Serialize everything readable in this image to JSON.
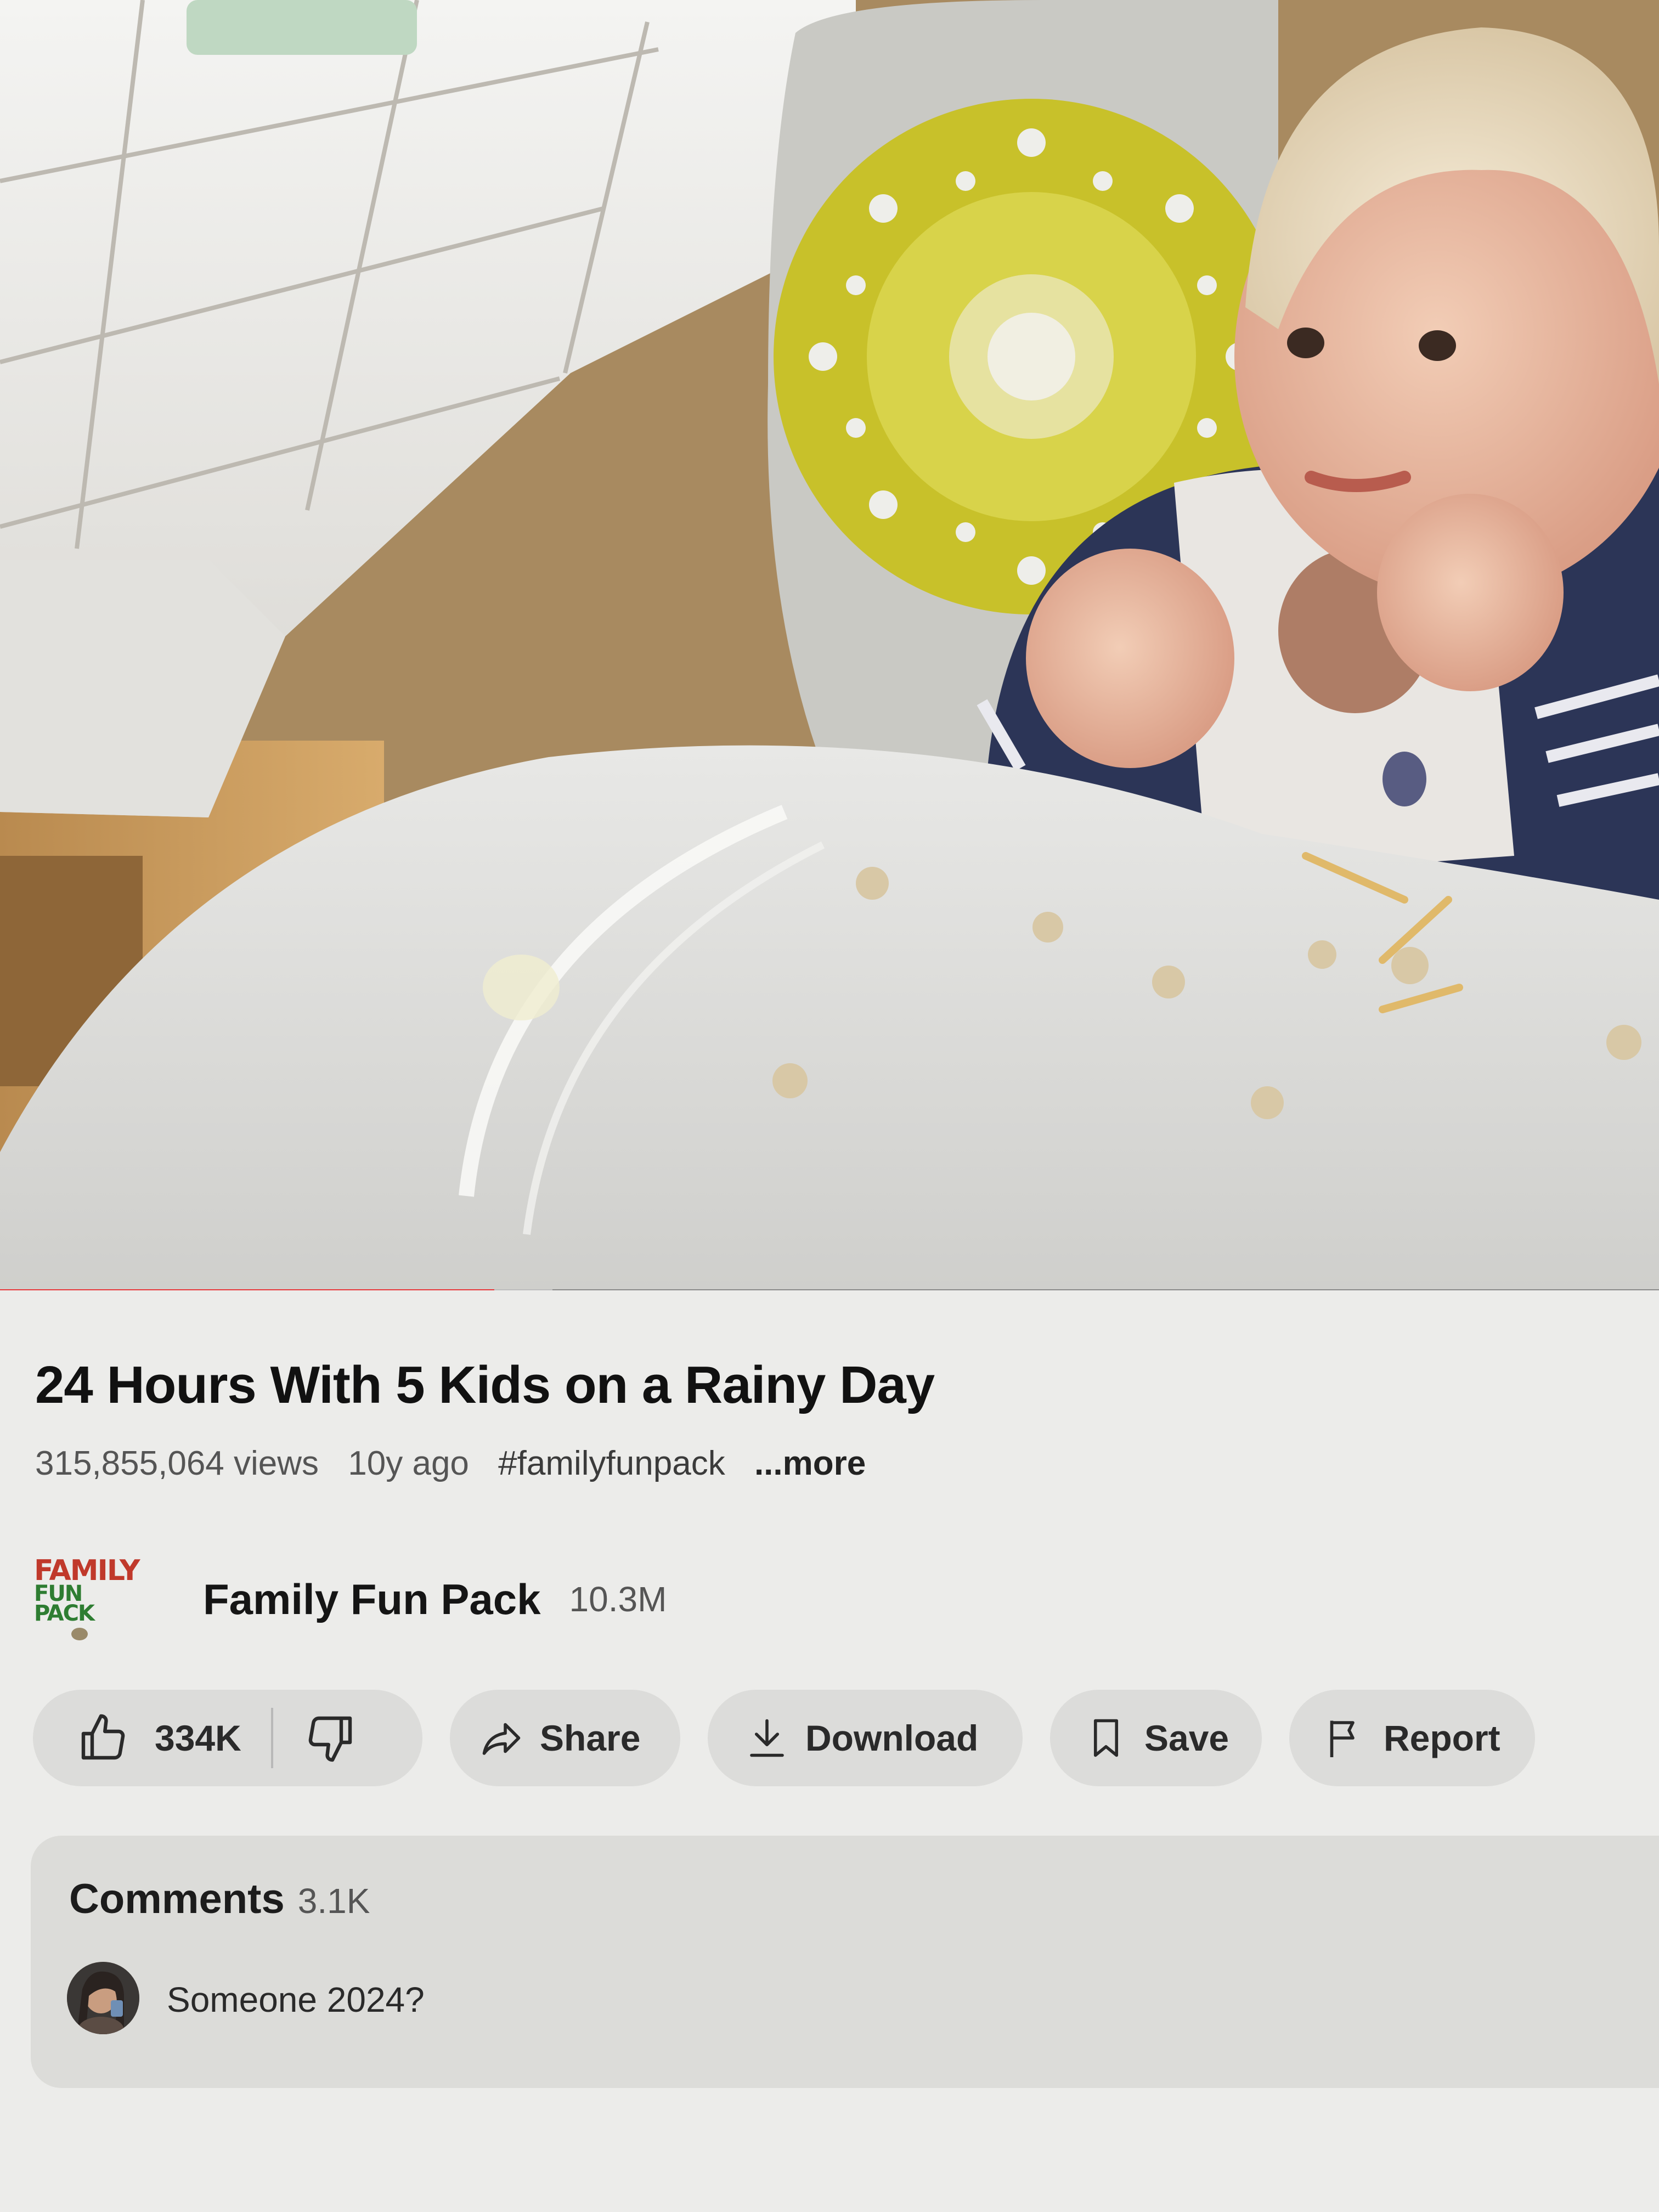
{
  "video": {
    "progress_played_fraction": 0.298,
    "progress_buffered_fraction": 0.333,
    "colors": {
      "played": "#e8393c",
      "buffered": "#bdbdbd",
      "track": "#8a8a8a"
    }
  },
  "title": "24 Hours With 5 Kids on a Rainy Day",
  "meta": {
    "views": "315,855,064 views",
    "age": "10y ago",
    "hashtag": "#familyfunpack",
    "more": "...more"
  },
  "channel": {
    "logo_line1": "FAMILY",
    "logo_line2": "FUN PACK",
    "name": "Family Fun Pack",
    "subscribers": "10.3M"
  },
  "actions": {
    "like_count": "334K",
    "share_label": "Share",
    "download_label": "Download",
    "save_label": "Save",
    "report_label": "Report",
    "icons": [
      "thumbs-up-icon",
      "thumbs-down-icon",
      "share-icon",
      "download-icon",
      "bookmark-icon",
      "flag-icon"
    ]
  },
  "comments": {
    "heading": "Comments",
    "count": "3.1K",
    "top_comment": "Someone 2024?"
  }
}
